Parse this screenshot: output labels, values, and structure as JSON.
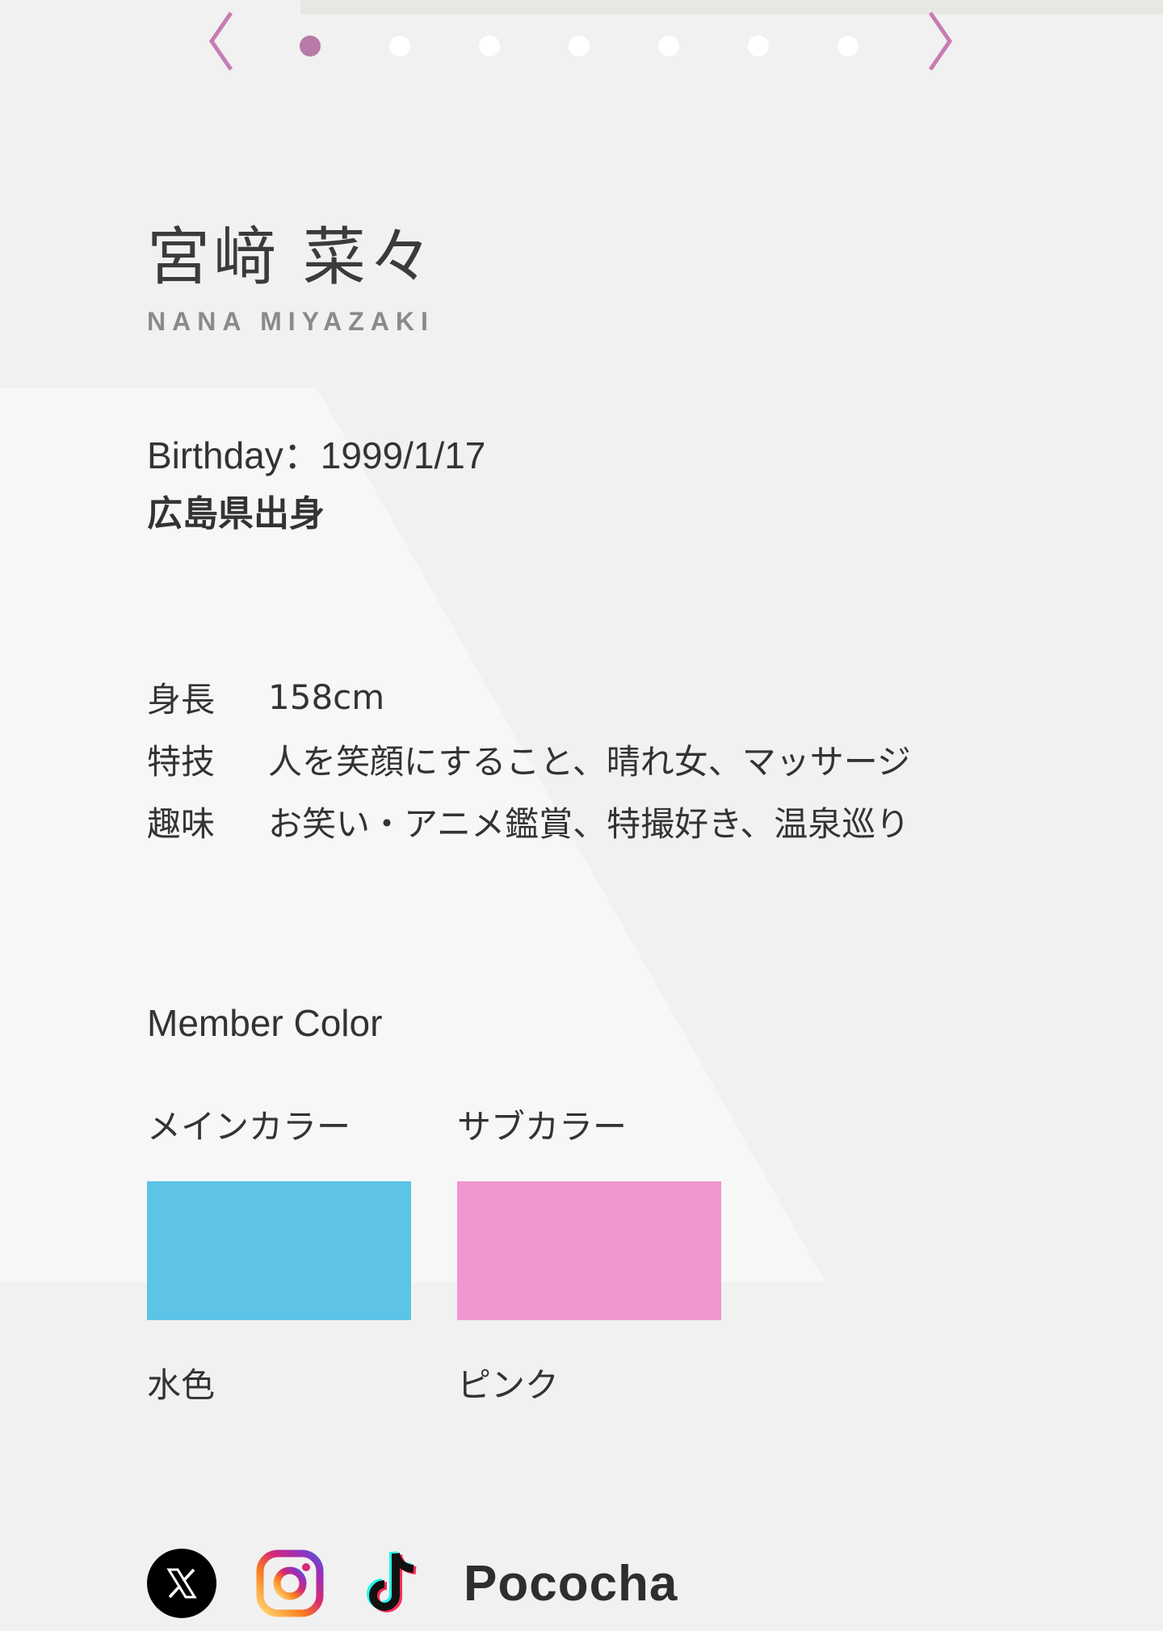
{
  "carousel": {
    "dots": [
      true,
      false,
      false,
      false,
      false,
      false,
      false
    ],
    "active_color": "#b87aa6",
    "arrow_color": "#c77bb4"
  },
  "profile": {
    "name_ja": "宮﨑 菜々",
    "name_en": "NANA MIYAZAKI",
    "birthday": "Birthday：1999/1/17",
    "origin": "広島県出身",
    "details": [
      {
        "label": "身長",
        "value": "158cm"
      },
      {
        "label": "特技",
        "value": "人を笑顔にすること、晴れ女、マッサージ"
      },
      {
        "label": "趣味",
        "value": "お笑い・アニメ鑑賞、特撮好き、温泉巡り"
      }
    ]
  },
  "member_color": {
    "title": "Member Color",
    "main": {
      "label": "メインカラー",
      "name": "水色",
      "hex": "#5dc3e7"
    },
    "sub": {
      "label": "サブカラー",
      "name": "ピンク",
      "hex": "#f097d0"
    }
  },
  "social": {
    "items": [
      {
        "name": "x-icon"
      },
      {
        "name": "instagram-icon"
      },
      {
        "name": "tiktok-icon"
      }
    ],
    "pococha_label": "Pococha"
  }
}
